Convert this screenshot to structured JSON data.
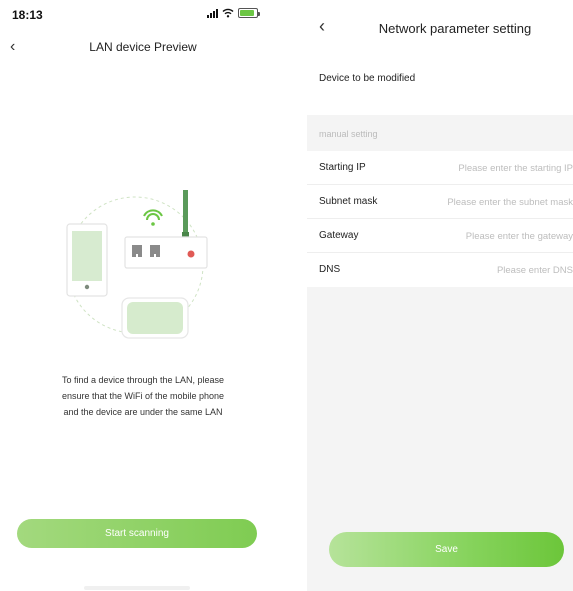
{
  "left": {
    "status_bar": {
      "time": "18:13",
      "location_icon": "location-arrow-icon",
      "battery_color": "#6cc644"
    },
    "nav": {
      "back_icon": "chevron-left-icon",
      "title": "LAN device Preview"
    },
    "illustration": {
      "icons": [
        "phone-icon",
        "router-icon",
        "wifi-icon",
        "device-box-icon"
      ],
      "accent": "#5a9a5a"
    },
    "instruction": {
      "line1": "To find a device through the LAN, please",
      "line2": "ensure that the WiFi of the mobile phone",
      "line3": "and the device are under the same LAN"
    },
    "scan_button": {
      "label": "Start scanning",
      "color": "#8fd262"
    }
  },
  "right": {
    "nav": {
      "back_icon": "chevron-left-icon",
      "title": "Network parameter setting"
    },
    "device_label": "Device to be modified",
    "section_label": "manual setting",
    "fields": [
      {
        "label": "Starting IP",
        "value": "",
        "placeholder": "Please enter the starting IP"
      },
      {
        "label": "Subnet mask",
        "value": "",
        "placeholder": "Please enter the subnet mask"
      },
      {
        "label": "Gateway",
        "value": "",
        "placeholder": "Please enter the gateway"
      },
      {
        "label": "DNS",
        "value": "",
        "placeholder": "Please enter DNS"
      }
    ],
    "save_button": {
      "label": "Save",
      "color": "#7fcf55"
    }
  }
}
